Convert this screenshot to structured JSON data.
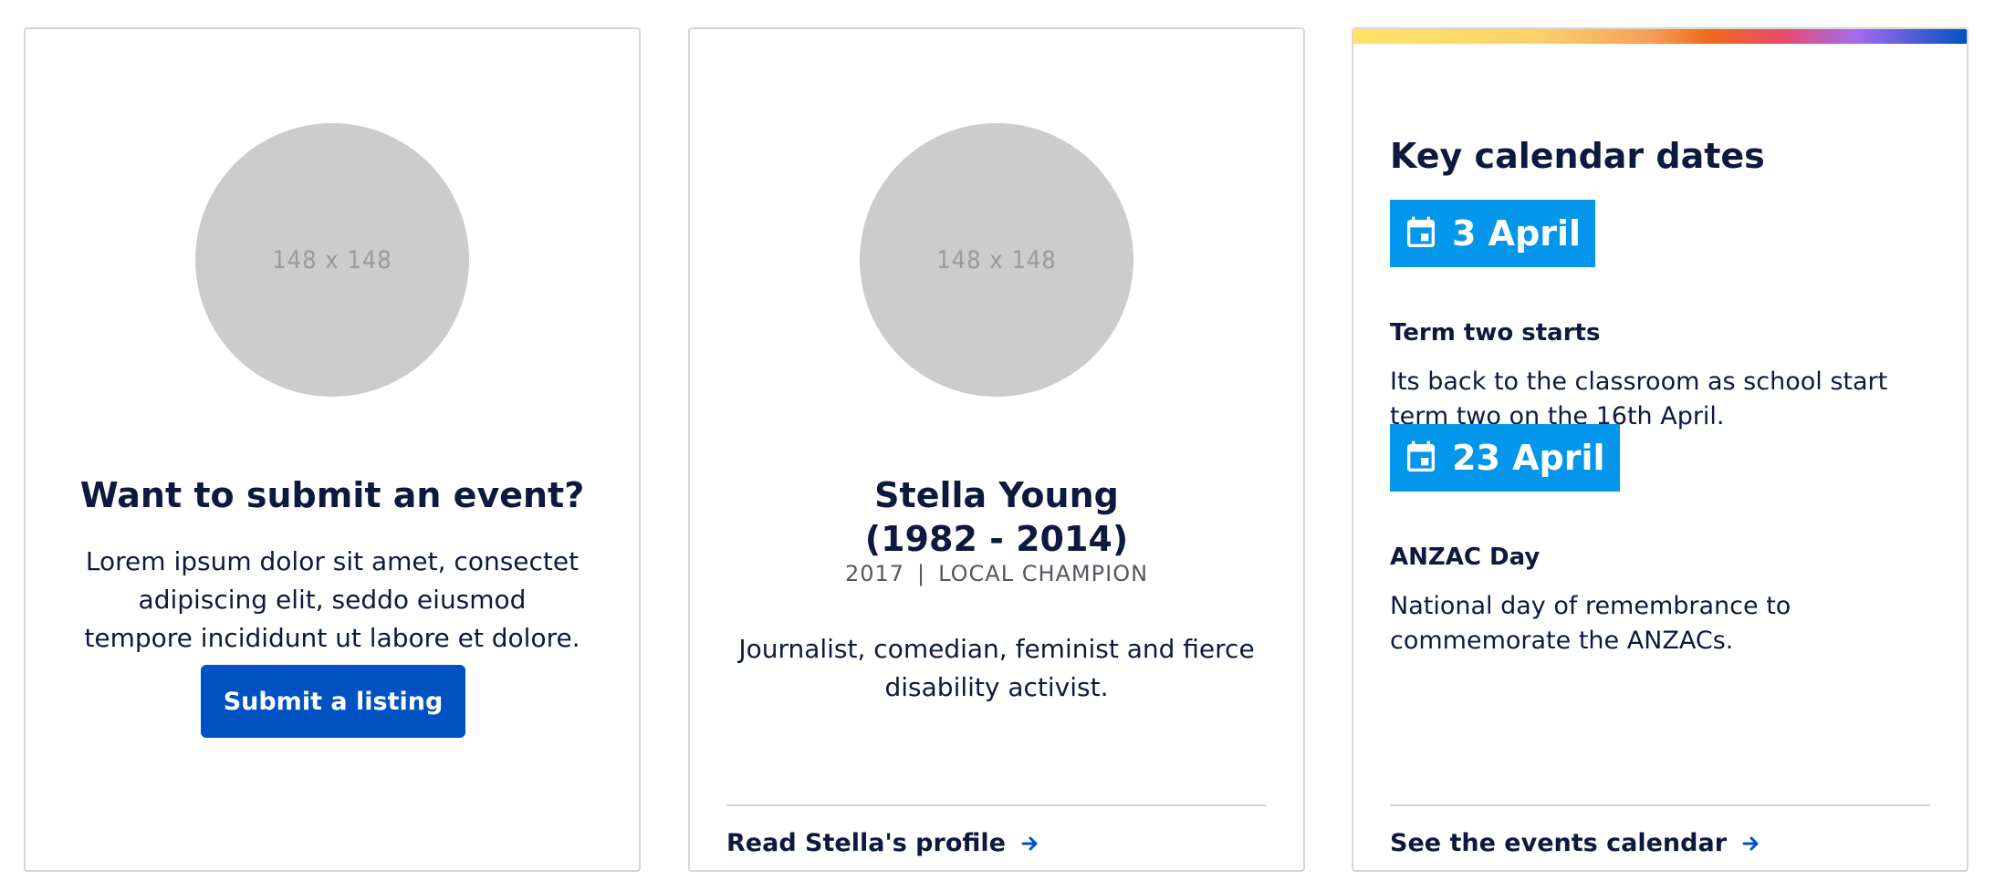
{
  "submit_card": {
    "avatar_text": "148 x 148",
    "title": "Want to submit an event?",
    "body": "Lorem ipsum dolor sit amet, consectet adipiscing elit, seddo eiusmod tempore incididunt ut labore et dolore.",
    "button_label": "Submit a listing"
  },
  "profile_card": {
    "avatar_text": "148 x 148",
    "name_line1": "Stella Young",
    "name_line2": "(1982 - 2014)",
    "year": "2017",
    "separator": "|",
    "category": "LOCAL CHAMPION",
    "body": "Journalist, comedian, feminist and fierce disability activist.",
    "link_label": "Read Stella's profile",
    "link_icon": "arrow-right-icon"
  },
  "calendar_card": {
    "heading": "Key calendar dates",
    "events": [
      {
        "date": "3 April",
        "title": "Term two starts",
        "description": "Its back to the classroom as school start term two on the 16th April."
      },
      {
        "date": "23 April",
        "title": "ANZAC Day",
        "description": "National day of remembrance to commemorate the ANZACs."
      }
    ],
    "link_label": "See the events calendar",
    "link_icon": "arrow-right-icon",
    "date_icon": "calendar-icon"
  },
  "colors": {
    "primary": "#0052c2",
    "date_chip": "#0396eb",
    "text": "#0e1a3d",
    "border": "#d6d6d6",
    "avatar_placeholder": "#cccccc"
  }
}
